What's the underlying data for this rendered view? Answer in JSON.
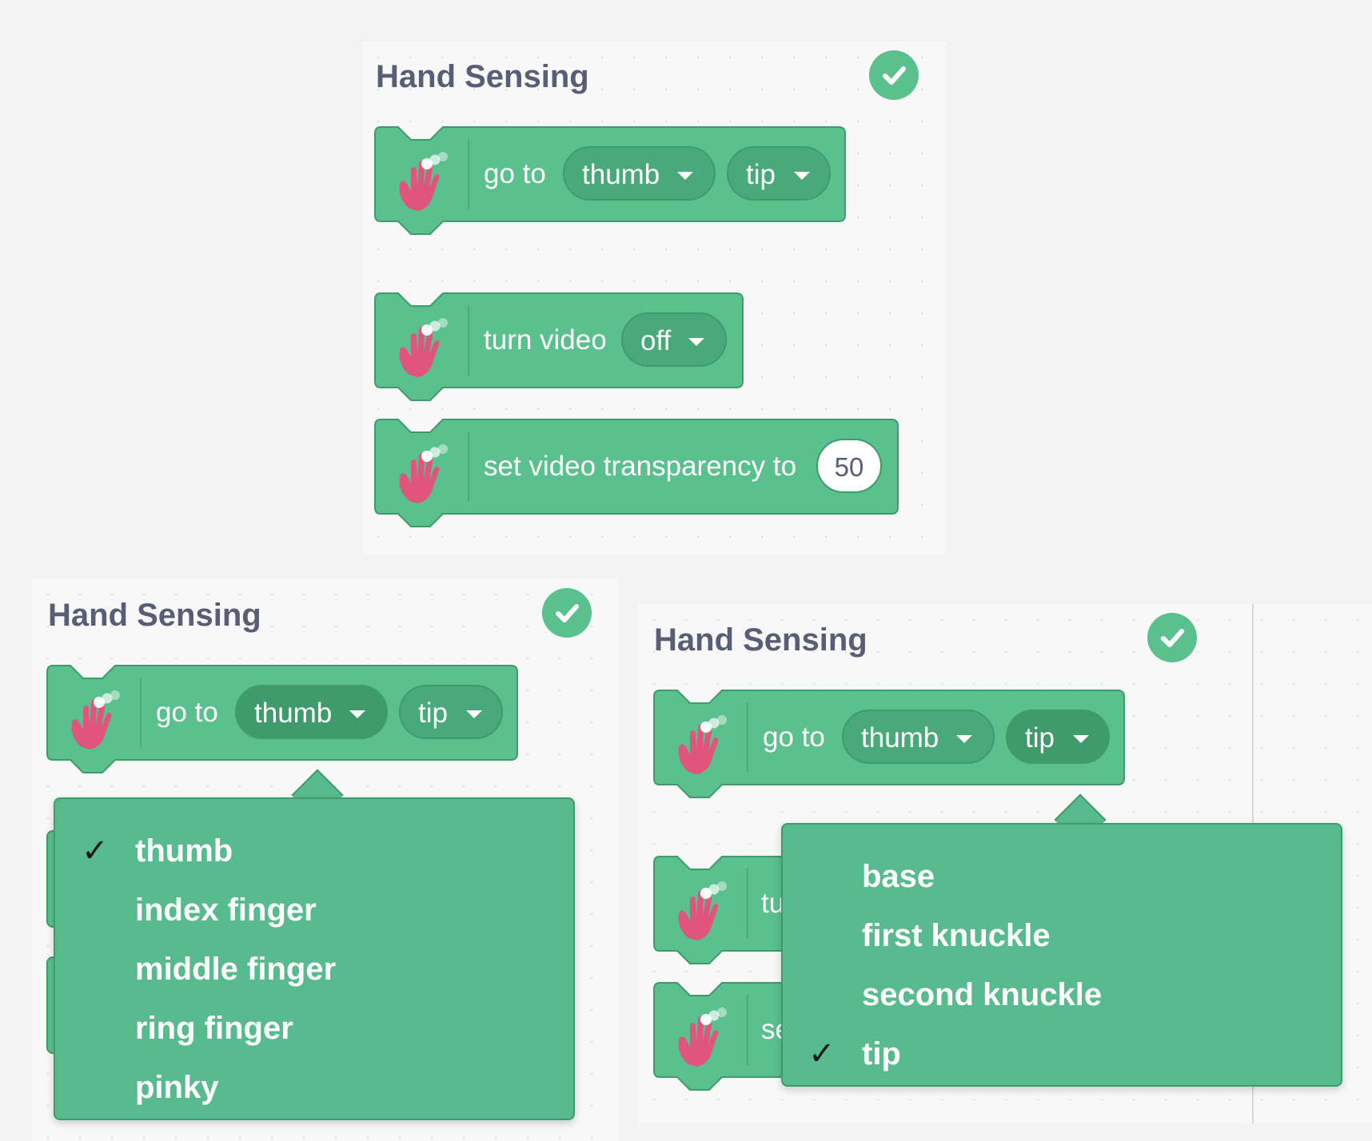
{
  "panels": [
    {
      "title": "Hand Sensing",
      "blocks": [
        {
          "label": "go to",
          "finger": "thumb",
          "point": "tip"
        },
        {
          "label": "turn video",
          "option": "off"
        },
        {
          "label": "set video transparency to",
          "value": "50"
        }
      ]
    },
    {
      "title": "Hand Sensing",
      "block": {
        "label": "go to",
        "finger": "thumb",
        "point": "tip"
      },
      "dropdown": {
        "items": [
          "thumb",
          "index finger",
          "middle finger",
          "ring finger",
          "pinky"
        ],
        "selected": "thumb"
      }
    },
    {
      "title": "Hand Sensing",
      "block": {
        "label": "go to",
        "finger": "thumb",
        "point": "tip"
      },
      "partial_labels": [
        "tu",
        "se"
      ],
      "dropdown": {
        "items": [
          "base",
          "first knuckle",
          "second knuckle",
          "tip"
        ],
        "selected": "tip"
      }
    }
  ],
  "check_mark": "✓",
  "colors": {
    "block": "#59c08e",
    "block_border": "#3f9a6c",
    "pill": "#4aa97a",
    "title": "#575e75",
    "hand": "#e0557d"
  }
}
